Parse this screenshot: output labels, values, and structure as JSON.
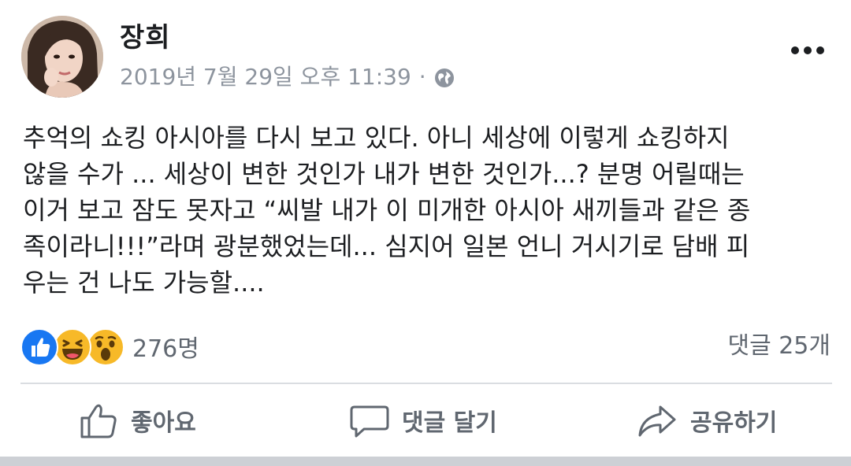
{
  "post": {
    "author": "장희",
    "timestamp": "2019년 7월 29일 오후 11:39",
    "separator": "·",
    "privacy_icon": "globe-icon",
    "more_icon": "more-dots-icon",
    "text": "추억의 쇼킹 아시아를 다시 보고 있다. 아니 세상에 이렇게 쇼킹하지\n않을 수가 ... 세상이 변한 것인가 내가 변한 것인가...? 분명 어릴때는\n이거 보고 잠도 못자고 “씨발 내가 이 미개한 아시아 새끼들과 같은 종\n족이라니!!!”라며 광분했었는데... 심지어 일본 언니 거시기로 담배 피\n우는 건 나도 가능할...."
  },
  "reactions": {
    "icons": [
      "like-reaction-icon",
      "haha-reaction-icon",
      "wow-reaction-icon"
    ],
    "count": "276명",
    "comments": "댓글 25개"
  },
  "actions": {
    "like": "좋아요",
    "comment": "댓글 달기",
    "share": "공유하기"
  },
  "colors": {
    "text": "#1c1e21",
    "meta": "#8d949e",
    "secondary": "#606770",
    "like_blue": "#1877f2",
    "emoji_yellow": "#f7b928",
    "divider": "#dadde1"
  }
}
